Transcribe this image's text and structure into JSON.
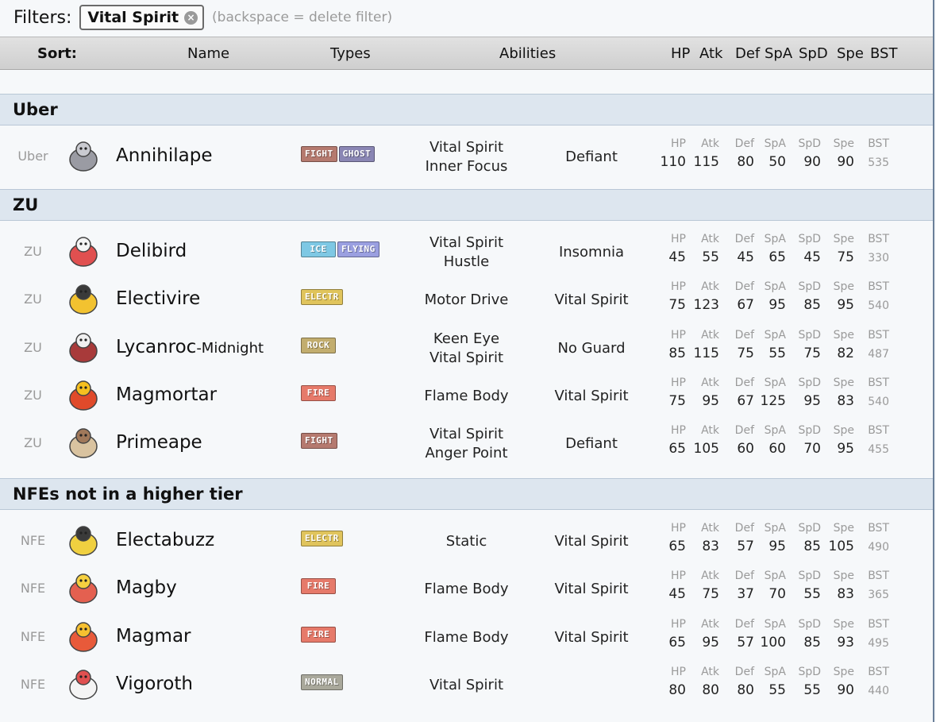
{
  "filterbar": {
    "label": "Filters:",
    "chip": "Vital Spirit",
    "chip_remove": "×",
    "hint": "(backspace = delete filter)"
  },
  "sortbar": {
    "sort": "Sort:",
    "name": "Name",
    "types": "Types",
    "abilities": "Abilities",
    "hp": "HP",
    "atk": "Atk",
    "def": "Def",
    "spa": "SpA",
    "spd": "SpD",
    "spe": "Spe",
    "bst": "BST"
  },
  "stat_labels": [
    "HP",
    "Atk",
    "Def",
    "SpA",
    "SpD",
    "Spe",
    "BST"
  ],
  "type_colors": {
    "FIGHT": "#b57a6f",
    "GHOST": "#8a86b4",
    "ICE": "#7ec8e4",
    "FLYING": "#9a9fe0",
    "ELECTR": "#e0c45c",
    "ROCK": "#c2ad6e",
    "FIRE": "#e67a6a",
    "NORMAL": "#a9a89b"
  },
  "sections": [
    {
      "title": "Uber",
      "rows": [
        {
          "tier": "Uber",
          "name": "Annihilape",
          "forme": "",
          "icon": "annihilape-sprite",
          "types": [
            "FIGHT",
            "GHOST"
          ],
          "abilities": [
            "Vital Spirit",
            "Inner Focus"
          ],
          "hidden": "Defiant",
          "stats": [
            "110",
            "115",
            "80",
            "50",
            "90",
            "90",
            "535"
          ]
        }
      ]
    },
    {
      "title": "ZU",
      "rows": [
        {
          "tier": "ZU",
          "name": "Delibird",
          "forme": "",
          "icon": "delibird-sprite",
          "types": [
            "ICE",
            "FLYING"
          ],
          "abilities": [
            "Vital Spirit",
            "Hustle"
          ],
          "hidden": "Insomnia",
          "stats": [
            "45",
            "55",
            "45",
            "65",
            "45",
            "75",
            "330"
          ]
        },
        {
          "tier": "ZU",
          "name": "Electivire",
          "forme": "",
          "icon": "electivire-sprite",
          "types": [
            "ELECTR"
          ],
          "abilities": [
            "Motor Drive"
          ],
          "hidden": "Vital Spirit",
          "stats": [
            "75",
            "123",
            "67",
            "95",
            "85",
            "95",
            "540"
          ]
        },
        {
          "tier": "ZU",
          "name": "Lycanroc",
          "forme": "-Midnight",
          "icon": "lycanroc-midnight-sprite",
          "types": [
            "ROCK"
          ],
          "abilities": [
            "Keen Eye",
            "Vital Spirit"
          ],
          "hidden": "No Guard",
          "stats": [
            "85",
            "115",
            "75",
            "55",
            "75",
            "82",
            "487"
          ]
        },
        {
          "tier": "ZU",
          "name": "Magmortar",
          "forme": "",
          "icon": "magmortar-sprite",
          "types": [
            "FIRE"
          ],
          "abilities": [
            "Flame Body"
          ],
          "hidden": "Vital Spirit",
          "stats": [
            "75",
            "95",
            "67",
            "125",
            "95",
            "83",
            "540"
          ]
        },
        {
          "tier": "ZU",
          "name": "Primeape",
          "forme": "",
          "icon": "primeape-sprite",
          "types": [
            "FIGHT"
          ],
          "abilities": [
            "Vital Spirit",
            "Anger Point"
          ],
          "hidden": "Defiant",
          "stats": [
            "65",
            "105",
            "60",
            "60",
            "70",
            "95",
            "455"
          ]
        }
      ]
    },
    {
      "title": "NFEs not in a higher tier",
      "rows": [
        {
          "tier": "NFE",
          "name": "Electabuzz",
          "forme": "",
          "icon": "electabuzz-sprite",
          "types": [
            "ELECTR"
          ],
          "abilities": [
            "Static"
          ],
          "hidden": "Vital Spirit",
          "stats": [
            "65",
            "83",
            "57",
            "95",
            "85",
            "105",
            "490"
          ]
        },
        {
          "tier": "NFE",
          "name": "Magby",
          "forme": "",
          "icon": "magby-sprite",
          "types": [
            "FIRE"
          ],
          "abilities": [
            "Flame Body"
          ],
          "hidden": "Vital Spirit",
          "stats": [
            "45",
            "75",
            "37",
            "70",
            "55",
            "83",
            "365"
          ]
        },
        {
          "tier": "NFE",
          "name": "Magmar",
          "forme": "",
          "icon": "magmar-sprite",
          "types": [
            "FIRE"
          ],
          "abilities": [
            "Flame Body"
          ],
          "hidden": "Vital Spirit",
          "stats": [
            "65",
            "95",
            "57",
            "100",
            "85",
            "93",
            "495"
          ]
        },
        {
          "tier": "NFE",
          "name": "Vigoroth",
          "forme": "",
          "icon": "vigoroth-sprite",
          "types": [
            "NORMAL"
          ],
          "abilities": [
            "Vital Spirit"
          ],
          "hidden": "",
          "stats": [
            "80",
            "80",
            "80",
            "55",
            "55",
            "90",
            "440"
          ]
        }
      ]
    }
  ]
}
